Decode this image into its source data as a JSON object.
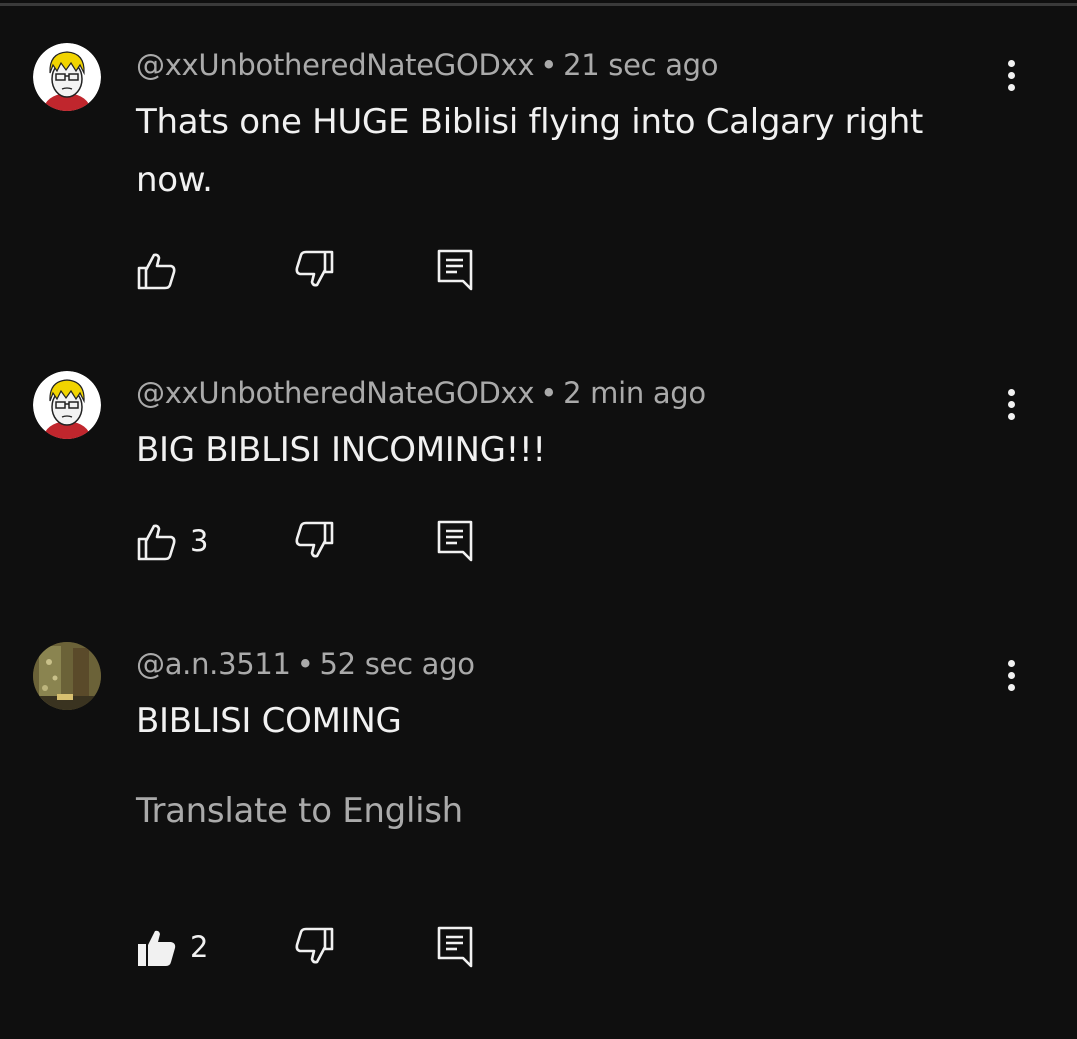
{
  "comments": [
    {
      "author": "@xxUnbotheredNateGODxx",
      "separator": "•",
      "time": "21 sec ago",
      "text": "Thats one HUGE Biblisi flying into Calgary right now.",
      "likes": "",
      "liked": false,
      "avatar": "cartoon-avatar-icon"
    },
    {
      "author": "@xxUnbotheredNateGODxx",
      "separator": "•",
      "time": "2 min ago",
      "text": "BIG BIBLISI INCOMING!!!",
      "likes": "3",
      "liked": false,
      "avatar": "cartoon-avatar-icon"
    },
    {
      "author": "@a.n.3511",
      "separator": "•",
      "time": "52 sec ago",
      "text": "BIBLISI COMING",
      "translate": "Translate to English",
      "likes": "2",
      "liked": true,
      "avatar": "photo-avatar-icon"
    }
  ],
  "colors": {
    "background": "#0f0f0f",
    "text": "#f1f1f1",
    "secondary": "#aaaaaa"
  }
}
